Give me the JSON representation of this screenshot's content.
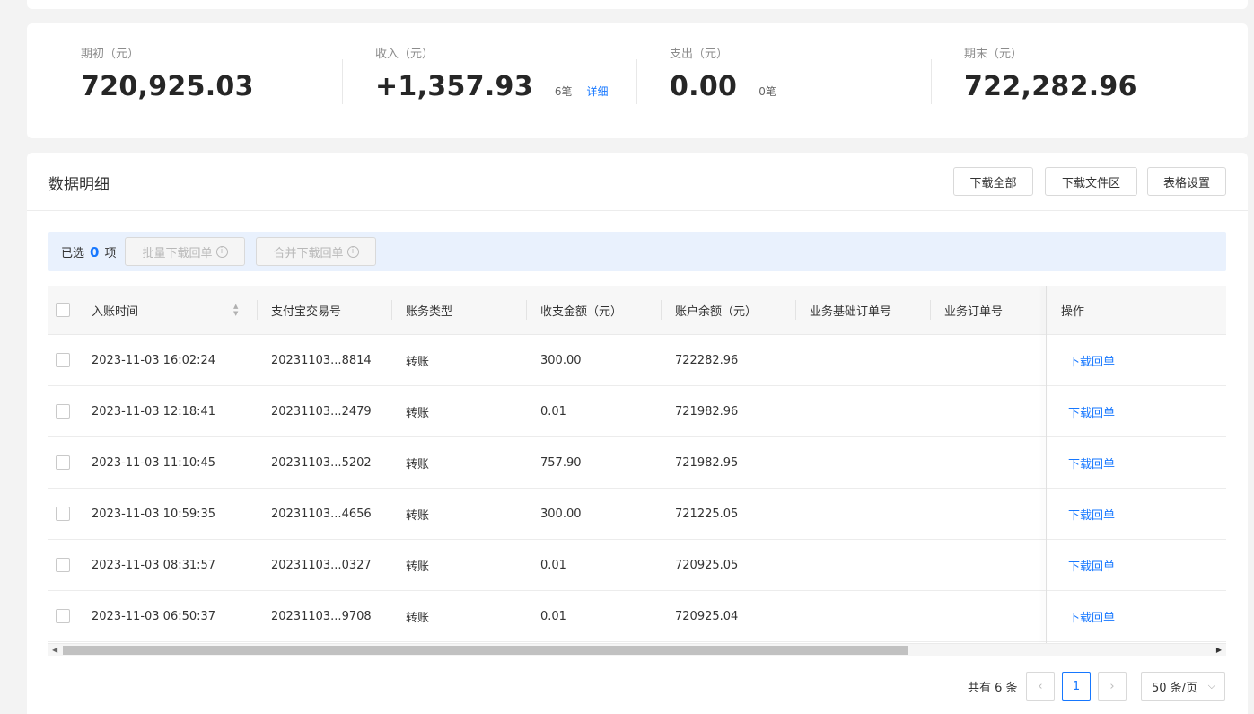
{
  "summary": {
    "opening": {
      "label": "期初（元）",
      "value": "720,925.03"
    },
    "income": {
      "label": "收入（元）",
      "value": "+1,357.93",
      "count": "6笔",
      "detail": "详细"
    },
    "expense": {
      "label": "支出（元）",
      "value": "0.00",
      "count": "0笔"
    },
    "closing": {
      "label": "期末（元）",
      "value": "722,282.96"
    }
  },
  "detail": {
    "title": "数据明细",
    "buttons": {
      "download_all": "下载全部",
      "download_area": "下载文件区",
      "table_settings": "表格设置"
    }
  },
  "selection": {
    "prefix": "已选",
    "count": "0",
    "suffix": "项",
    "batch_download": "批量下载回单",
    "merge_download": "合并下载回单"
  },
  "table": {
    "headers": [
      "入账时间",
      "支付宝交易号",
      "账务类型",
      "收支金额（元）",
      "账户余额（元）",
      "业务基础订单号",
      "业务订单号",
      "操作"
    ],
    "rows": [
      {
        "time": "2023-11-03 16:02:24",
        "trade_no": "20231103...8814",
        "type": "转账",
        "amount": "300.00",
        "balance": "722282.96",
        "base_order": "",
        "order": "",
        "action": "下载回单"
      },
      {
        "time": "2023-11-03 12:18:41",
        "trade_no": "20231103...2479",
        "type": "转账",
        "amount": "0.01",
        "balance": "721982.96",
        "base_order": "",
        "order": "",
        "action": "下载回单"
      },
      {
        "time": "2023-11-03 11:10:45",
        "trade_no": "20231103...5202",
        "type": "转账",
        "amount": "757.90",
        "balance": "721982.95",
        "base_order": "",
        "order": "",
        "action": "下载回单"
      },
      {
        "time": "2023-11-03 10:59:35",
        "trade_no": "20231103...4656",
        "type": "转账",
        "amount": "300.00",
        "balance": "721225.05",
        "base_order": "",
        "order": "",
        "action": "下载回单"
      },
      {
        "time": "2023-11-03 08:31:57",
        "trade_no": "20231103...0327",
        "type": "转账",
        "amount": "0.01",
        "balance": "720925.05",
        "base_order": "",
        "order": "",
        "action": "下载回单"
      },
      {
        "time": "2023-11-03 06:50:37",
        "trade_no": "20231103...9708",
        "type": "转账",
        "amount": "0.01",
        "balance": "720925.04",
        "base_order": "",
        "order": "",
        "action": "下载回单"
      }
    ]
  },
  "pagination": {
    "total": "共有 6 条",
    "current_page": "1",
    "prev": "‹",
    "next": "›",
    "page_size": "50 条/页"
  },
  "colors": {
    "accent": "#1677ff",
    "selection_bg": "#e9f1fd"
  }
}
